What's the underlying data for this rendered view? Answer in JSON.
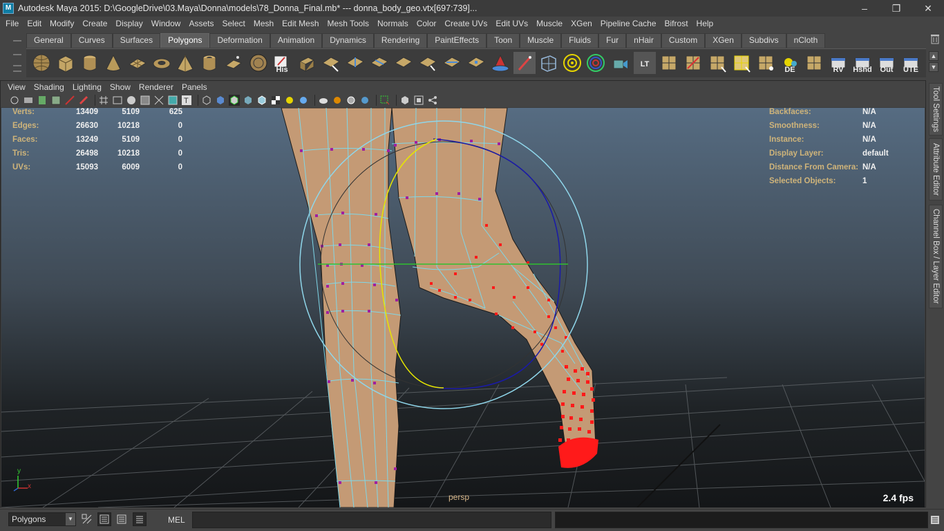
{
  "window": {
    "title": "Autodesk Maya 2015: D:\\GoogleDrive\\03.Maya\\Donna\\models\\78_Donna_Final.mb*   ---   donna_body_geo.vtx[697:739]...",
    "app_icon_text": "M"
  },
  "menubar": [
    "File",
    "Edit",
    "Modify",
    "Create",
    "Display",
    "Window",
    "Assets",
    "Select",
    "Mesh",
    "Edit Mesh",
    "Mesh Tools",
    "Normals",
    "Color",
    "Create UVs",
    "Edit UVs",
    "Muscle",
    "XGen",
    "Pipeline Cache",
    "Bifrost",
    "Help"
  ],
  "shelf": {
    "tabs": [
      "General",
      "Curves",
      "Surfaces",
      "Polygons",
      "Deformation",
      "Animation",
      "Dynamics",
      "Rendering",
      "PaintEffects",
      "Toon",
      "Muscle",
      "Fluids",
      "Fur",
      "nHair",
      "Custom",
      "XGen",
      "Subdivs",
      "nCloth"
    ],
    "active_tab": "Polygons",
    "labeled_icons": {
      "his": "His",
      "lt": "LT",
      "de": "DE",
      "rv": "RV",
      "hshd": "Hshd",
      "out": "Out",
      "ute": "UTE"
    }
  },
  "panel_menu": [
    "View",
    "Shading",
    "Lighting",
    "Show",
    "Renderer",
    "Panels"
  ],
  "hud": {
    "left": [
      {
        "label": "Verts:",
        "values": [
          "13409",
          "5109",
          "625"
        ]
      },
      {
        "label": "Edges:",
        "values": [
          "26630",
          "10218",
          "0"
        ]
      },
      {
        "label": "Faces:",
        "values": [
          "13249",
          "5109",
          "0"
        ]
      },
      {
        "label": "Tris:",
        "values": [
          "26498",
          "10218",
          "0"
        ]
      },
      {
        "label": "UVs:",
        "values": [
          "15093",
          "6009",
          "0"
        ]
      }
    ],
    "right": [
      {
        "label": "Backfaces:",
        "value": "N/A"
      },
      {
        "label": "Smoothness:",
        "value": "N/A"
      },
      {
        "label": "Instance:",
        "value": "N/A"
      },
      {
        "label": "Display Layer:",
        "value": "default"
      },
      {
        "label": "Distance From Camera:",
        "value": "N/A"
      },
      {
        "label": "Selected Objects:",
        "value": "1"
      }
    ],
    "camera": "persp",
    "fps": "2.4 fps",
    "axis_y": "y",
    "axis_x": "x"
  },
  "side_tabs": [
    "Tool Settings",
    "Attribute Editor",
    "Channel Box / Layer Editor"
  ],
  "cmdline": {
    "mode": "Polygons",
    "mel_label": "MEL"
  },
  "colors": {
    "hud_label": "#cfb47a",
    "skin": "#c49a75",
    "wire": "#7fd7e8",
    "selected_vertex": "#ff1a1a",
    "unselected_vertex": "#a020a0",
    "manip_yellow": "#e6e600",
    "manip_blue": "#1a1aa8",
    "manip_green": "#30c030",
    "manip_outer": "#8fd6ea"
  }
}
